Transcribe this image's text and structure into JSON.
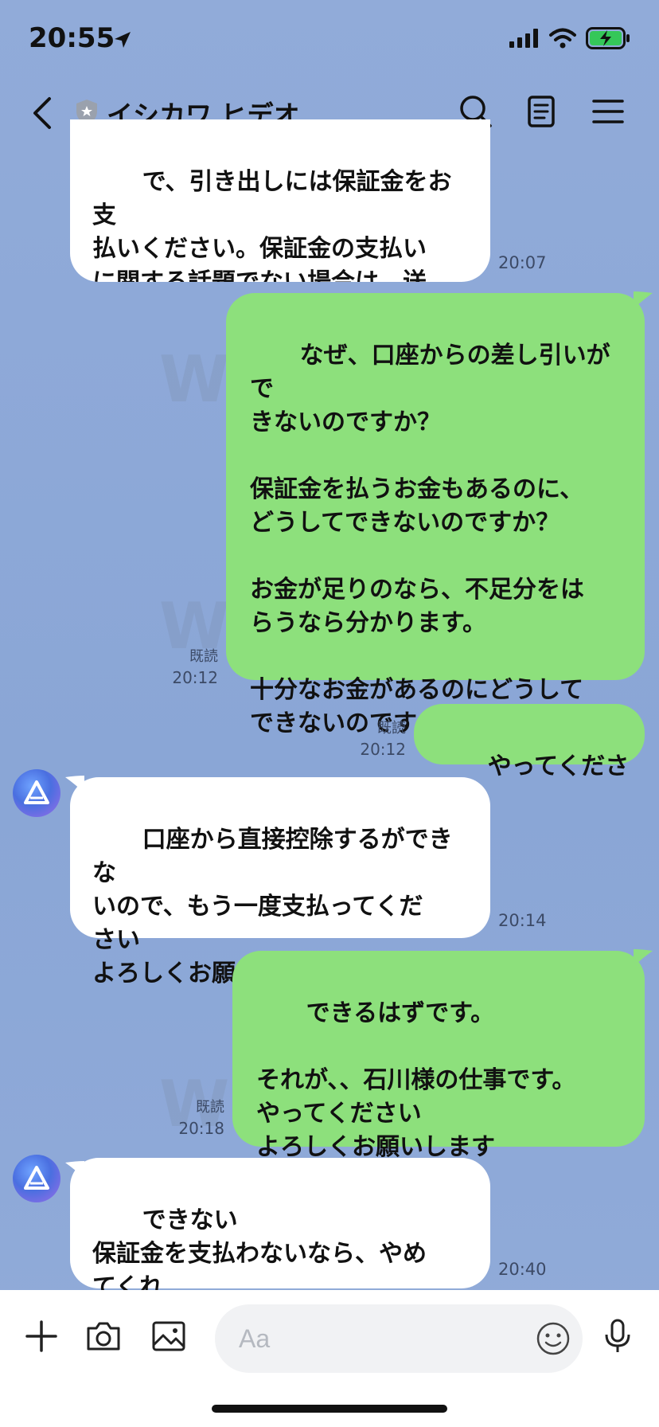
{
  "status": {
    "time": "20:55"
  },
  "header": {
    "contact_name": "イシカワ ヒデオ",
    "icons": [
      "back-chevron-icon",
      "shield-icon",
      "search-icon",
      "notes-icon",
      "menu-icon"
    ]
  },
  "messages": [
    {
      "side": "in",
      "text": "で、引き出しには保証金をお支\n払いください。保証金の支払い\nに関する話題でない場合は、送\nらないでください",
      "time": "20:07"
    },
    {
      "side": "out",
      "text": "なぜ、口座からの差し引いがで\nきないのですか？\n\n保証金を払うお金もあるのに、\nどうしてできないのですか？\n\nお金が足りのなら、不足分をは\nらうなら分かります。\n\n十分なお金があるのにどうして\nできないのですか？",
      "read": "既読",
      "time": "20:12"
    },
    {
      "side": "out",
      "text": "やってください",
      "read": "既読",
      "time": "20:12"
    },
    {
      "side": "in",
      "text": "口座から直接控除するができな\nいので、もう一度支払ってくだ\nさい\nよろしくお願いします",
      "time": "20:14"
    },
    {
      "side": "out",
      "text": "できるはずです。\n\nそれが、、石川様の仕事です。\nやってください\nよろしくお願いします",
      "read": "既読",
      "time": "20:18"
    },
    {
      "side": "in",
      "text": "できない\n保証金を支払わないなら、やめ\nてくれ",
      "time": "20:40"
    }
  ],
  "input": {
    "placeholder": "Aa"
  },
  "colors": {
    "outgoing": "#8de07c",
    "incoming": "#ffffff",
    "background": "#8fa9d8"
  }
}
